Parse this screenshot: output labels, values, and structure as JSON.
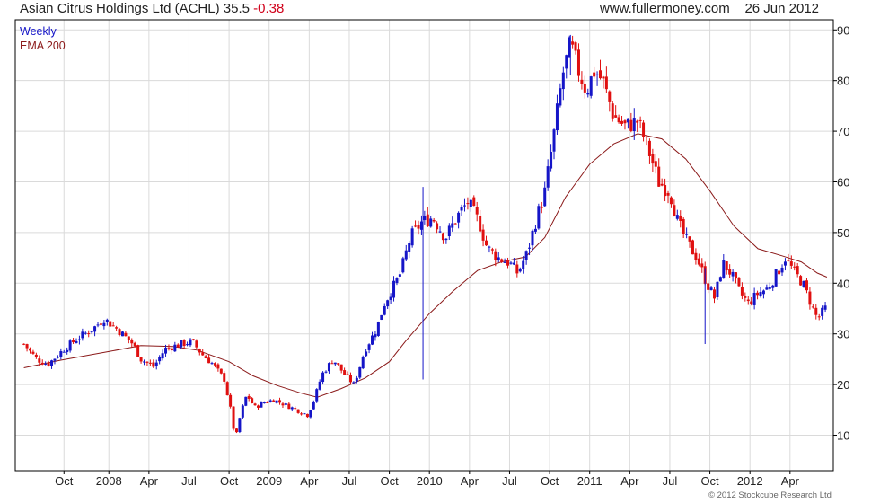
{
  "header": {
    "security": "Asian Citrus Holdings Ltd (ACHL)",
    "last": "35.5",
    "change": "-0.38",
    "site": "www.fullermoney.com",
    "date": "26 Jun 2012"
  },
  "legend": {
    "series1": "Weekly",
    "series2": "EMA 200"
  },
  "copyright": "© 2012 Stockcube Research Ltd",
  "colors": {
    "up": "#1515c8",
    "down": "#e01010",
    "ema": "#8b1a1a",
    "grid": "#dadada",
    "legend1": "#1515c8",
    "legend2": "#8b1a1a"
  },
  "chart_data": {
    "type": "candlestick",
    "y_ticks": [
      10,
      20,
      30,
      40,
      50,
      60,
      70,
      80,
      90
    ],
    "ylim": [
      3,
      92
    ],
    "x_ticks": [
      {
        "label": "Oct",
        "t": 0.72
      },
      {
        "label": "2008",
        "t": 1.0
      },
      {
        "label": "Apr",
        "t": 1.25
      },
      {
        "label": "Jul",
        "t": 1.5
      },
      {
        "label": "Oct",
        "t": 1.75
      },
      {
        "label": "2009",
        "t": 2.0
      },
      {
        "label": "Apr",
        "t": 2.25
      },
      {
        "label": "Jul",
        "t": 2.5
      },
      {
        "label": "Oct",
        "t": 2.75
      },
      {
        "label": "2010",
        "t": 3.0
      },
      {
        "label": "Apr",
        "t": 3.25
      },
      {
        "label": "Jul",
        "t": 3.5
      },
      {
        "label": "Oct",
        "t": 3.75
      },
      {
        "label": "2011",
        "t": 4.0
      },
      {
        "label": "Apr",
        "t": 4.25
      },
      {
        "label": "Jul",
        "t": 4.5
      },
      {
        "label": "Oct",
        "t": 4.75
      },
      {
        "label": "2012",
        "t": 5.0
      },
      {
        "label": "Apr",
        "t": 5.25
      }
    ],
    "weekly_close_path": [
      [
        0.47,
        28
      ],
      [
        0.55,
        25
      ],
      [
        0.62,
        24
      ],
      [
        0.72,
        27
      ],
      [
        0.8,
        29
      ],
      [
        0.9,
        31
      ],
      [
        0.97,
        33
      ],
      [
        1.05,
        31
      ],
      [
        1.15,
        28
      ],
      [
        1.2,
        25
      ],
      [
        1.28,
        23.5
      ],
      [
        1.35,
        27
      ],
      [
        1.45,
        28
      ],
      [
        1.52,
        28.5
      ],
      [
        1.58,
        26
      ],
      [
        1.65,
        24
      ],
      [
        1.72,
        21
      ],
      [
        1.76,
        15
      ],
      [
        1.79,
        9
      ],
      [
        1.82,
        14
      ],
      [
        1.86,
        18
      ],
      [
        1.91,
        15.5
      ],
      [
        1.97,
        16.5
      ],
      [
        2.03,
        17
      ],
      [
        2.1,
        16
      ],
      [
        2.17,
        15
      ],
      [
        2.24,
        14
      ],
      [
        2.28,
        17
      ],
      [
        2.33,
        22
      ],
      [
        2.4,
        25
      ],
      [
        2.47,
        22
      ],
      [
        2.53,
        20
      ],
      [
        2.6,
        27
      ],
      [
        2.67,
        31
      ],
      [
        2.72,
        36
      ],
      [
        2.77,
        39
      ],
      [
        2.82,
        42
      ],
      [
        2.88,
        49
      ],
      [
        2.95,
        52
      ],
      [
        3.02,
        53
      ],
      [
        3.1,
        49
      ],
      [
        3.17,
        53
      ],
      [
        3.24,
        56
      ],
      [
        3.31,
        52
      ],
      [
        3.36,
        47
      ],
      [
        3.43,
        45
      ],
      [
        3.5,
        44
      ],
      [
        3.55,
        42
      ],
      [
        3.61,
        46
      ],
      [
        3.67,
        53
      ],
      [
        3.72,
        58
      ],
      [
        3.78,
        70
      ],
      [
        3.83,
        81
      ],
      [
        3.88,
        87
      ],
      [
        3.93,
        82
      ],
      [
        3.98,
        78
      ],
      [
        4.03,
        82
      ],
      [
        4.08,
        80
      ],
      [
        4.15,
        73
      ],
      [
        4.22,
        71
      ],
      [
        4.3,
        72
      ],
      [
        4.37,
        66
      ],
      [
        4.43,
        60
      ],
      [
        4.5,
        58
      ],
      [
        4.55,
        52
      ],
      [
        4.61,
        48
      ],
      [
        4.67,
        45
      ],
      [
        4.73,
        40
      ],
      [
        4.78,
        37
      ],
      [
        4.83,
        44
      ],
      [
        4.88,
        42
      ],
      [
        4.94,
        38
      ],
      [
        4.99,
        36
      ],
      [
        5.05,
        38
      ],
      [
        5.11,
        39
      ],
      [
        5.17,
        42
      ],
      [
        5.22,
        45
      ],
      [
        5.28,
        42
      ],
      [
        5.33,
        40
      ],
      [
        5.38,
        36
      ],
      [
        5.42,
        33
      ],
      [
        5.47,
        35
      ]
    ],
    "ema_200": [
      [
        0.47,
        23.3
      ],
      [
        0.7,
        24.8
      ],
      [
        1.0,
        26.5
      ],
      [
        1.2,
        27.7
      ],
      [
        1.4,
        27.5
      ],
      [
        1.55,
        26.8
      ],
      [
        1.75,
        24.5
      ],
      [
        1.9,
        21.7
      ],
      [
        2.05,
        19.8
      ],
      [
        2.2,
        18.3
      ],
      [
        2.3,
        17.5
      ],
      [
        2.45,
        19.2
      ],
      [
        2.6,
        21.3
      ],
      [
        2.75,
        24.5
      ],
      [
        2.85,
        28.5
      ],
      [
        3.0,
        34
      ],
      [
        3.15,
        38.5
      ],
      [
        3.3,
        42.5
      ],
      [
        3.45,
        44.2
      ],
      [
        3.6,
        45.2
      ],
      [
        3.72,
        49
      ],
      [
        3.85,
        57
      ],
      [
        4.0,
        63.5
      ],
      [
        4.15,
        67.5
      ],
      [
        4.3,
        69.5
      ],
      [
        4.45,
        68.5
      ],
      [
        4.6,
        64.5
      ],
      [
        4.75,
        58.2
      ],
      [
        4.9,
        51.3
      ],
      [
        5.05,
        46.8
      ],
      [
        5.2,
        45.4
      ],
      [
        5.32,
        44.2
      ],
      [
        5.42,
        42
      ],
      [
        5.48,
        41.2
      ]
    ],
    "spikes": [
      {
        "t": 2.96,
        "low": 21,
        "high": 59
      },
      {
        "t": 3.88,
        "low": 81,
        "high": 89
      },
      {
        "t": 4.72,
        "low": 28,
        "high": 43
      }
    ]
  }
}
